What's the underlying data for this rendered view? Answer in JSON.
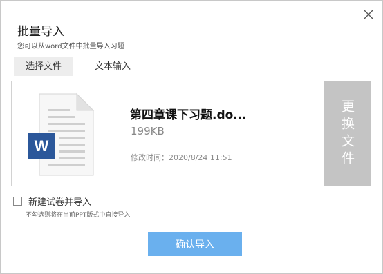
{
  "dialog": {
    "title": "批量导入",
    "subtitle": "您可以从word文件中批量导入习题",
    "close_icon": "close-icon"
  },
  "tabs": [
    {
      "label": "选择文件",
      "active": true
    },
    {
      "label": "文本输入",
      "active": false
    }
  ],
  "file": {
    "icon": "word-document-icon",
    "icon_letter": "W",
    "name": "第四章课下习题.do...",
    "size": "199KB",
    "modified": "修改时间：2020/8/24 11:51",
    "replace_label": "更换文件"
  },
  "option": {
    "checked": false,
    "label": "新建试卷并导入",
    "hint": "不勾选则将在当前PPT版式中直接导入"
  },
  "confirm_label": "确认导入",
  "colors": {
    "accent": "#6ab0ee",
    "word_blue": "#2b579a",
    "replace_bg": "#c4c4c4",
    "tab_active_bg": "#ededed"
  }
}
